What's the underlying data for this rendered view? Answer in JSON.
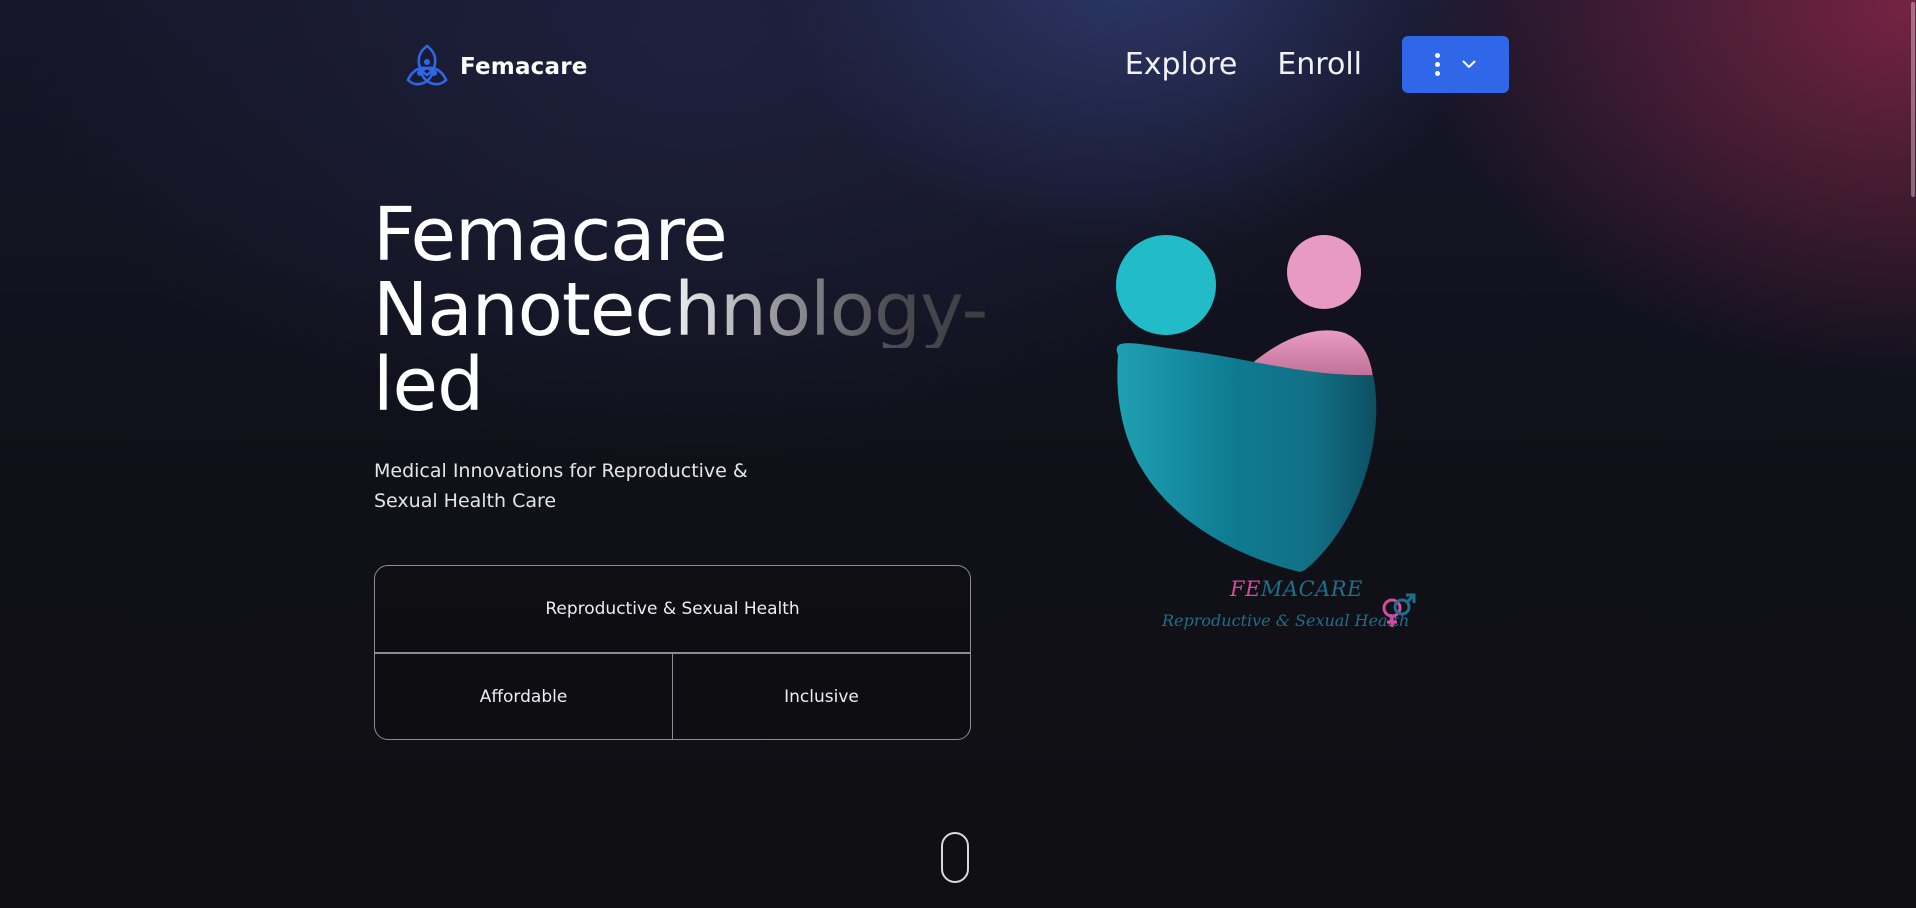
{
  "header": {
    "brand": "Femacare",
    "nav": [
      {
        "label": "Explore"
      },
      {
        "label": "Enroll"
      }
    ],
    "menu_button_color": "#2f67e8"
  },
  "hero": {
    "title_line1": "Femacare",
    "title_line2": "Nanotechnology-",
    "title_line3": "led",
    "subtitle": "Medical Innovations for Reproductive & Sexual Health Care"
  },
  "features": {
    "top": "Reproductive & Sexual Health",
    "left": "Affordable",
    "right": "Inclusive"
  },
  "illustration": {
    "brand_fe": "FE",
    "brand_rest": "MACARE",
    "tagline": "Reproductive & Sexual Health",
    "colors": {
      "teal": "#22bcc8",
      "pink": "#e79ac3",
      "heart_dark": "#0e5a70",
      "brand_pink": "#d64aa0",
      "brand_blue": "#1f6f8c"
    }
  },
  "icons": {
    "logo": "triquetra-logo-icon",
    "menu": "kebab-menu-icon",
    "chevron": "chevron-down-icon",
    "gender": "gender-symbol-icon",
    "scroll": "scroll-mouse-icon"
  }
}
